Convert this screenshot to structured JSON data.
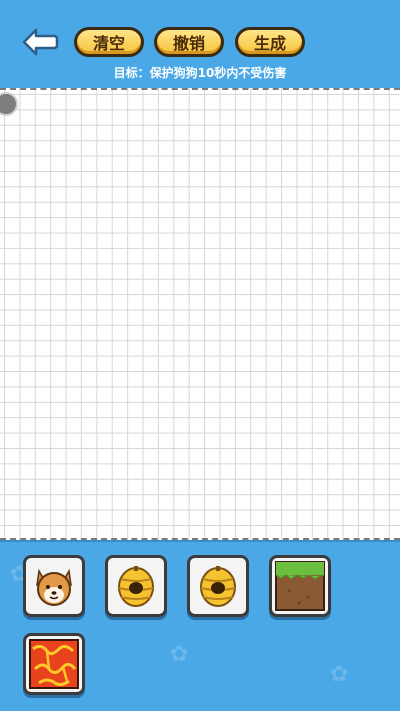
{
  "toolbar": {
    "clear_label": "清空",
    "undo_label": "撤销",
    "generate_label": "生成"
  },
  "goal_text": "目标：保护狗狗10秒内不受伤害",
  "palette": {
    "items": [
      {
        "name": "dog",
        "icon": "dog-face-icon"
      },
      {
        "name": "beehive-1",
        "icon": "beehive-icon"
      },
      {
        "name": "beehive-2",
        "icon": "beehive-icon"
      },
      {
        "name": "grass-block",
        "icon": "grass-block-icon"
      },
      {
        "name": "lava-block",
        "icon": "lava-block-icon"
      }
    ]
  },
  "colors": {
    "background": "#4aa8e6",
    "button_fill": "#f7c33b",
    "button_text": "#4a2c0a",
    "grid_line": "#d7d7d7"
  }
}
